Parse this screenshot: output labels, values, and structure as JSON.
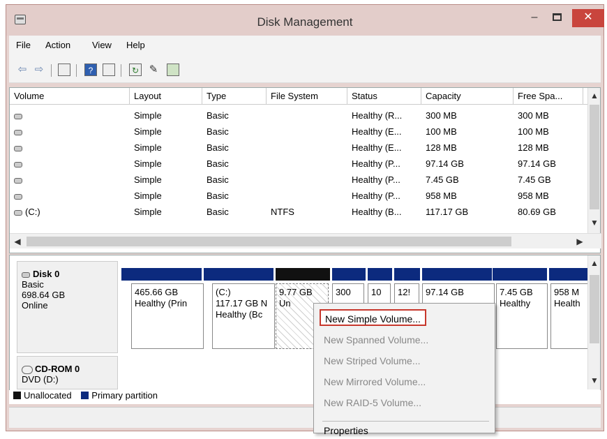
{
  "window": {
    "title": "Disk Management",
    "minimize": "–",
    "close": "✕"
  },
  "menu": [
    "File",
    "Action",
    "View",
    "Help"
  ],
  "toolbar": [
    "back-icon",
    "forward-icon",
    "console-tree-icon",
    "help-icon",
    "properties-list-icon",
    "refresh-icon",
    "properties-icon",
    "disk-settings-icon"
  ],
  "volumes": {
    "headers": [
      "Volume",
      "Layout",
      "Type",
      "File System",
      "Status",
      "Capacity",
      "Free Spa..."
    ],
    "rows": [
      [
        "",
        "Simple",
        "Basic",
        "",
        "Healthy (R...",
        "300 MB",
        "300 MB"
      ],
      [
        "",
        "Simple",
        "Basic",
        "",
        "Healthy (E...",
        "100 MB",
        "100 MB"
      ],
      [
        "",
        "Simple",
        "Basic",
        "",
        "Healthy (E...",
        "128 MB",
        "128 MB"
      ],
      [
        "",
        "Simple",
        "Basic",
        "",
        "Healthy (P...",
        "97.14 GB",
        "97.14 GB"
      ],
      [
        "",
        "Simple",
        "Basic",
        "",
        "Healthy (P...",
        "7.45 GB",
        "7.45 GB"
      ],
      [
        "",
        "Simple",
        "Basic",
        "",
        "Healthy (P...",
        "958 MB",
        "958 MB"
      ],
      [
        "(C:)",
        "Simple",
        "Basic",
        "NTFS",
        "Healthy (B...",
        "117.17 GB",
        "80.69 GB"
      ]
    ]
  },
  "disk0": {
    "name": "Disk 0",
    "type": "Basic",
    "size": "698.64 GB",
    "state": "Online",
    "partitions": [
      {
        "title": "",
        "size": "465.66 GB",
        "status": "Healthy (Prin"
      },
      {
        "title": "(C:)",
        "size": "117.17 GB N",
        "status": "Healthy (Bc"
      },
      {
        "title": "",
        "size": "9.77 GB",
        "status": "Un"
      },
      {
        "title": "",
        "size": "300",
        "status": ""
      },
      {
        "title": "",
        "size": "10",
        "status": ""
      },
      {
        "title": "",
        "size": "12!",
        "status": ""
      },
      {
        "title": "",
        "size": "97.14 GB",
        "status": ""
      },
      {
        "title": "",
        "size": "7.45 GB",
        "status": "Healthy"
      },
      {
        "title": "",
        "size": "958 M",
        "status": "Health"
      }
    ]
  },
  "cdrom": {
    "name": "CD-ROM 0",
    "drive": "DVD (D:)"
  },
  "legend": {
    "unallocated": "Unallocated",
    "primary": "Primary partition",
    "unallocated_color": "#111111",
    "primary_color": "#0c2a7e"
  },
  "context_menu": {
    "items": [
      "New Simple Volume...",
      "New Spanned Volume...",
      "New Striped Volume...",
      "New Mirrored Volume...",
      "New RAID-5 Volume...",
      "Properties"
    ]
  }
}
